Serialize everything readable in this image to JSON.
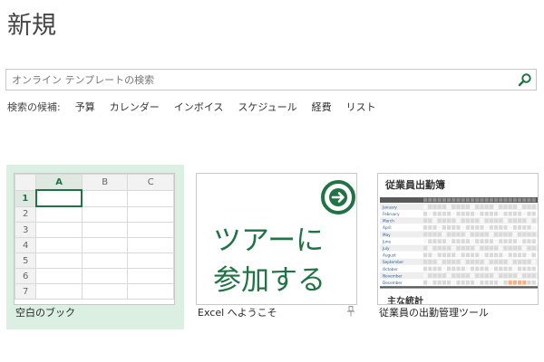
{
  "page_title": "新規",
  "search": {
    "placeholder": "オンライン テンプレートの検索"
  },
  "suggestions": {
    "label": "検索の候補:",
    "items": [
      "予算",
      "カレンダー",
      "インボイス",
      "スケジュール",
      "経費",
      "リスト"
    ]
  },
  "tiles": {
    "blank": {
      "caption": "空白のブック",
      "columns": [
        "A",
        "B",
        "C"
      ],
      "rows": [
        "1",
        "2",
        "3",
        "4",
        "5",
        "6",
        "7"
      ]
    },
    "tour": {
      "caption": "Excel へようこそ",
      "line1": "ツアーに",
      "line2": "参加する"
    },
    "attendance": {
      "caption": "従業員の出勤管理ツール",
      "title": "従業員出勤簿",
      "months": [
        "January",
        "February",
        "March",
        "April",
        "May",
        "June",
        "July",
        "August",
        "September",
        "October",
        "November",
        "December"
      ],
      "footer": "主な統計"
    }
  },
  "colors": {
    "accent": "#217346",
    "selection_bg": "#dcefe3",
    "highlight": "#f4b183"
  }
}
